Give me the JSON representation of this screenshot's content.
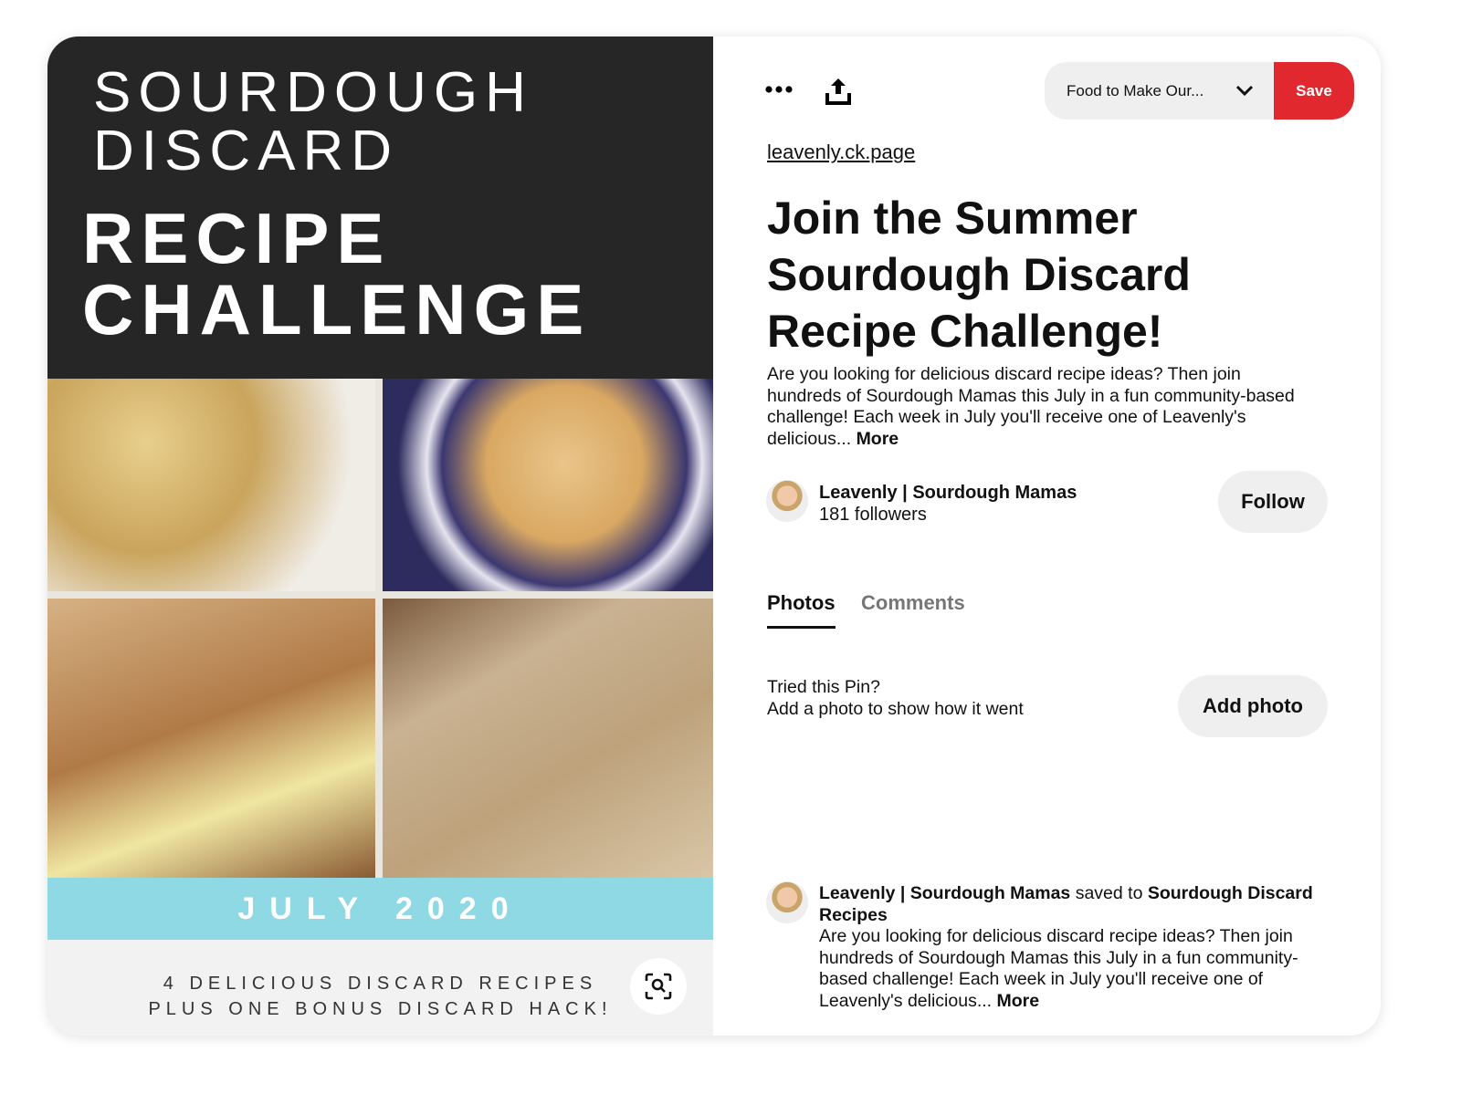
{
  "pin_image": {
    "line1": "SOURDOUGH",
    "line2": "DISCARD",
    "line3": "RECIPE",
    "line4": "CHALLENGE",
    "band": "JULY 2020",
    "foot1": "4 DELICIOUS DISCARD RECIPES",
    "foot2": "PLUS ONE BONUS DISCARD HACK!",
    "colors": {
      "header": "#262626",
      "band": "#8fd9e4"
    }
  },
  "toolbar": {
    "more_icon": "ellipsis-icon",
    "share_icon": "share-upload-icon",
    "board_name": "Food to Make Our...",
    "save_label": "Save",
    "save_color": "#e0282e"
  },
  "pin": {
    "source_link": "leavenly.ck.page",
    "title": "Join the Summer Sourdough Discard Recipe Challenge!",
    "description": "Are you looking for delicious discard recipe ideas? Then join hundreds of Sourdough Mamas this July in a fun community-based challenge! Each week in July you'll receive one of Leavenly's delicious...",
    "more": "More"
  },
  "creator": {
    "name": "Leavenly | Sourdough Mamas",
    "followers": "181 followers",
    "follow_label": "Follow"
  },
  "tabs": [
    {
      "label": "Photos",
      "active": true
    },
    {
      "label": "Comments",
      "active": false
    }
  ],
  "tried": {
    "line1": "Tried this Pin?",
    "line2": "Add a photo to show how it went",
    "button": "Add photo"
  },
  "activity": {
    "user": "Leavenly | Sourdough Mamas",
    "verb": "saved to",
    "board": "Sourdough Discard Recipes",
    "text": "Are you looking for delicious discard recipe ideas? Then join hundreds of Sourdough Mamas this July in a fun community-based challenge! Each week in July you'll receive one of Leavenly's delicious...",
    "more": "More"
  }
}
